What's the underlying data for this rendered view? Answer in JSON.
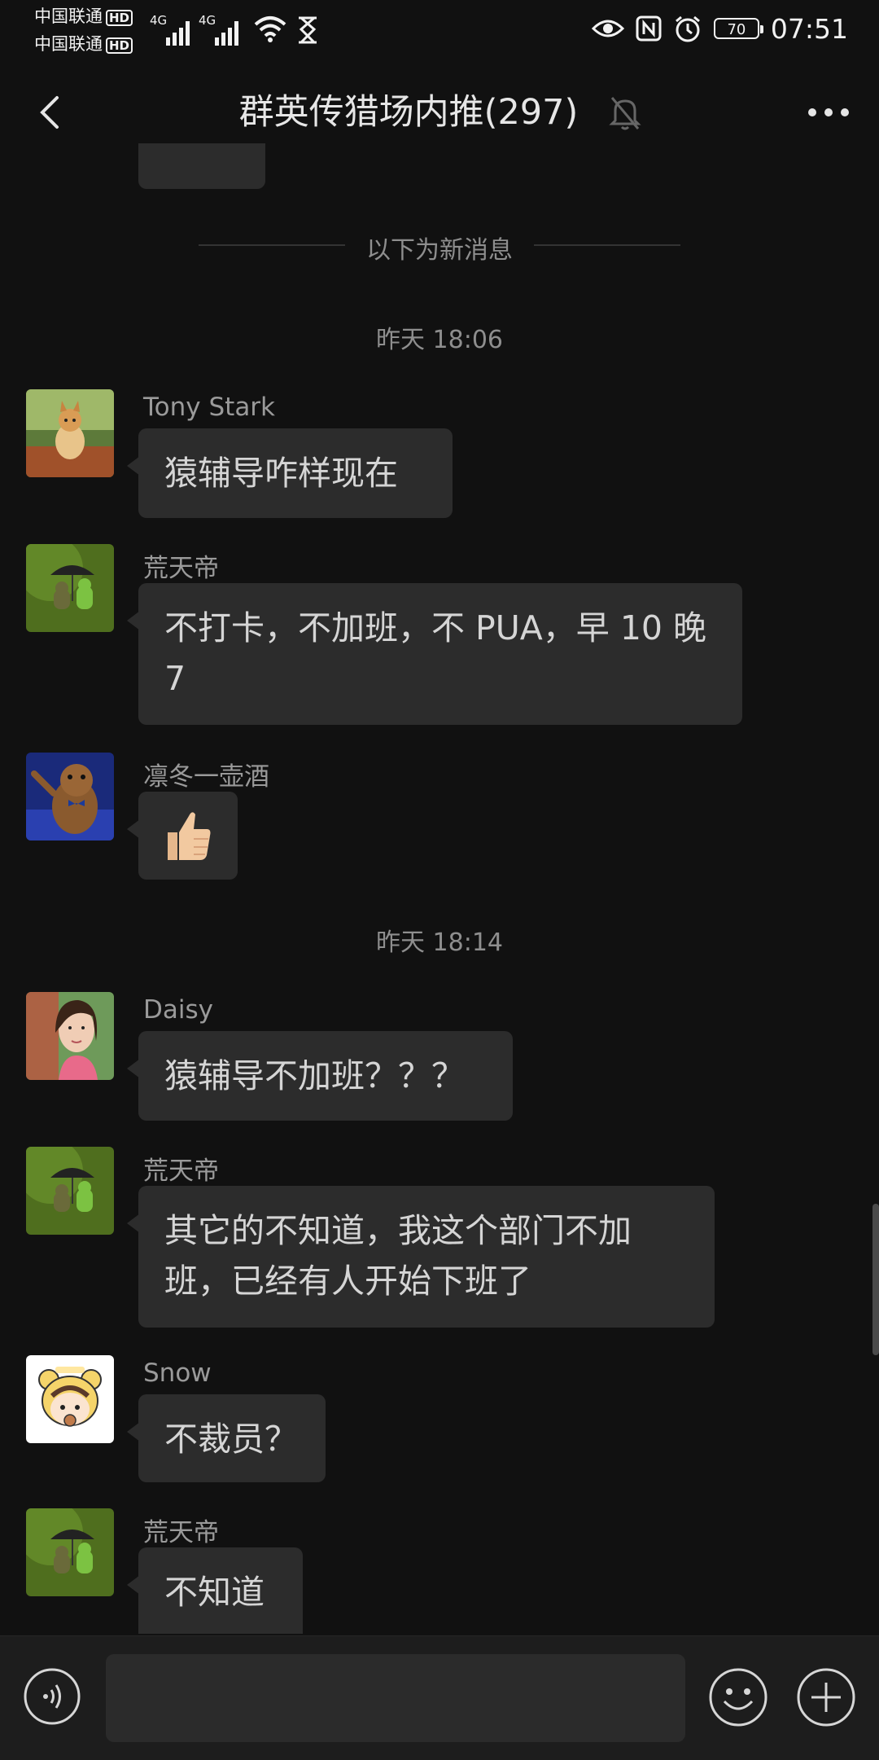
{
  "status": {
    "carrier1": "中国联通",
    "carrier2": "中国联通",
    "hd": "HD",
    "network1": "4G",
    "network2": "4G",
    "battery": "70",
    "time": "07:51"
  },
  "header": {
    "title": "群英传猎场内推(297)"
  },
  "divider_text": "以下为新消息",
  "timestamps": [
    "昨天 18:06",
    "昨天 18:14"
  ],
  "messages": [
    {
      "sender": "Tony Stark",
      "text": "猿辅导咋样现在"
    },
    {
      "sender": "荒天帝",
      "text": "不打卡，不加班，不 PUA，早 10 晚 7"
    },
    {
      "sender": "凛冬一壶酒",
      "text": "👍"
    },
    {
      "sender": "Daisy",
      "text": "猿辅导不加班？？？"
    },
    {
      "sender": "荒天帝",
      "text": "其它的不知道，我这个部门不加班，已经有人开始下班了"
    },
    {
      "sender": "Snow",
      "text": "不裁员？"
    },
    {
      "sender": "荒天帝",
      "text": "不知道"
    }
  ],
  "input": {
    "placeholder": ""
  },
  "colors": {
    "background": "#111111",
    "bubble": "#2c2c2c",
    "text": "#d5d5d5",
    "muted": "#8e8e8e"
  },
  "icons": [
    "back-arrow-icon",
    "mute-bell-icon",
    "more-dots-icon",
    "voice-icon",
    "emoji-icon",
    "plus-icon"
  ]
}
